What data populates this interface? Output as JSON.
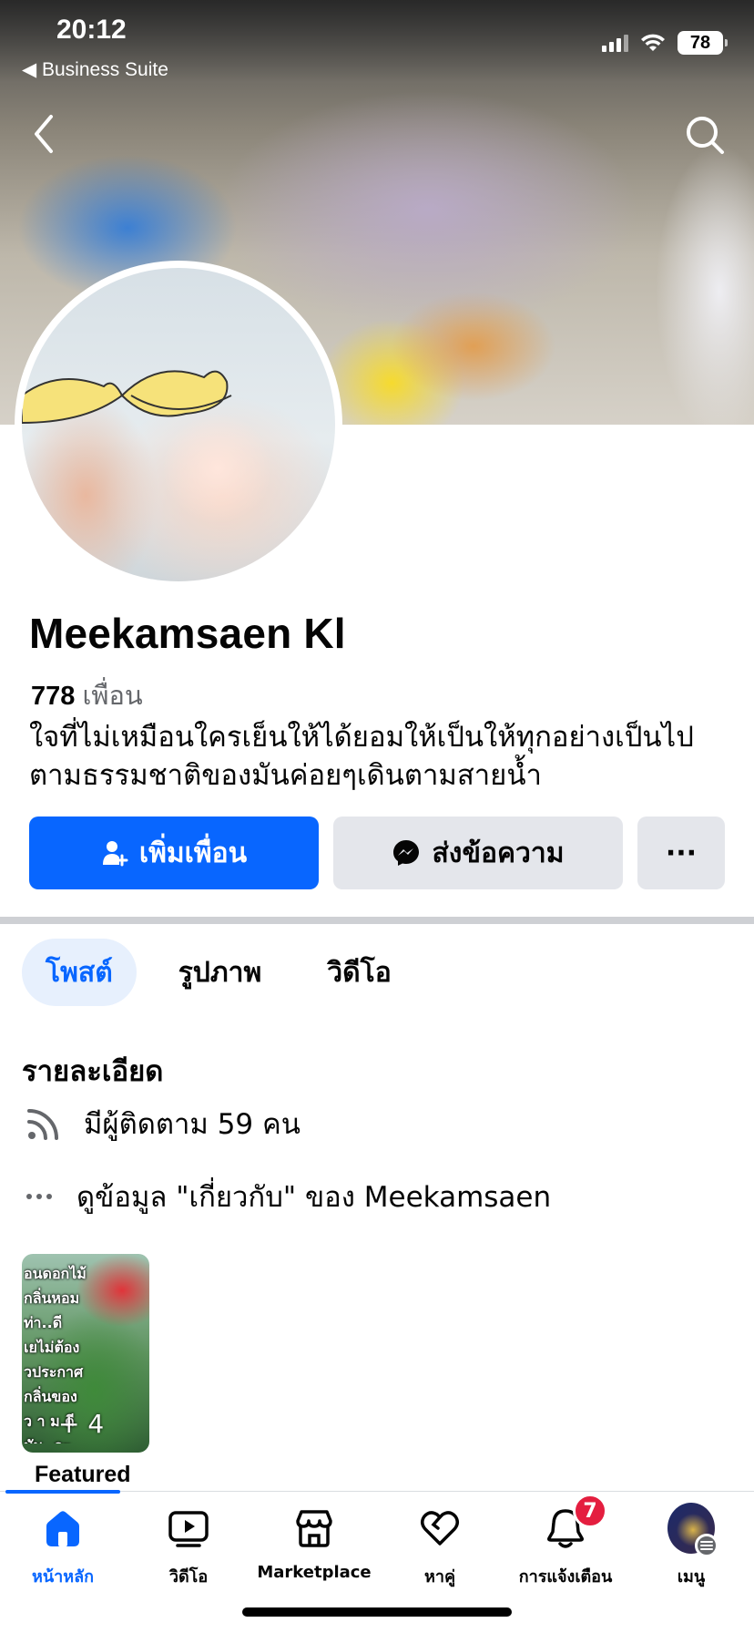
{
  "status_bar": {
    "time": "20:12",
    "back_app": "◀ Business Suite",
    "battery": "78"
  },
  "header": {
    "back_icon": "chevron-left-icon",
    "search_icon": "search-icon"
  },
  "profile": {
    "name": "Meekamsaen Kl",
    "friends_count": "778",
    "friends_label": "เพื่อน",
    "bio": "ใจที่ไม่เหมือนใครเย็นให้ได้ยอมให้เป็นให้ทุกอย่างเป็นไปตามธรรมชาติของมันค่อยๆเดินตามสายน้ำ"
  },
  "actions": {
    "add_friend": "เพิ่มเพื่อน",
    "message": "ส่งข้อความ",
    "more": "···"
  },
  "tabs": [
    {
      "label": "โพสต์",
      "active": true
    },
    {
      "label": "รูปภาพ",
      "active": false
    },
    {
      "label": "วิดีโอ",
      "active": false
    }
  ],
  "details": {
    "title": "รายละเอียด",
    "followers": "มีผู้ติดตาม 59 คน",
    "about": "ดูข้อมูล \"เกี่ยวกับ\" ของ Meekamsaen"
  },
  "featured": {
    "thumb_text": "อนดอกไม้\nกลิ่นหอม\nท่า..ดี\nเยไม่ต้อง\nวประกาศ\nกลิ่นของ\nว า ม ดี\nมัน..จะ",
    "more_count": "+ 4",
    "label": "Featured"
  },
  "bottom_nav": [
    {
      "label": "หน้าหลัก",
      "icon": "home-icon",
      "active": true
    },
    {
      "label": "วิดีโอ",
      "icon": "video-icon",
      "active": false
    },
    {
      "label": "Marketplace",
      "icon": "marketplace-icon",
      "active": false
    },
    {
      "label": "หาคู่",
      "icon": "heart-icon",
      "active": false
    },
    {
      "label": "การแจ้งเตือน",
      "icon": "bell-icon",
      "active": false,
      "badge": "7"
    },
    {
      "label": "เมนู",
      "icon": "menu-avatar",
      "active": false
    }
  ],
  "colors": {
    "accent": "#0866ff",
    "secondary_button": "#e4e6eb",
    "badge": "#e41e3f"
  }
}
